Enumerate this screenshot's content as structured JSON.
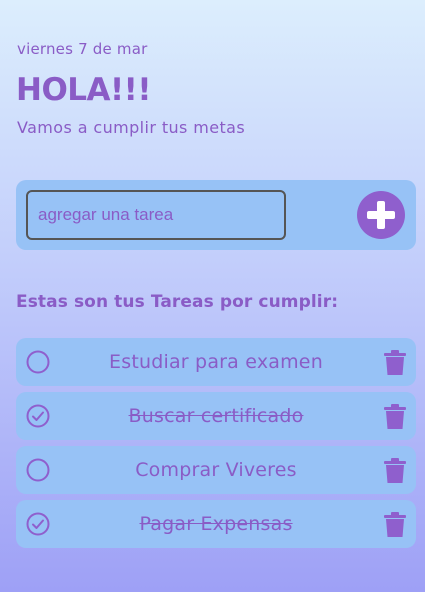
{
  "header": {
    "date": "viernes 7 de mar",
    "title": "HOLA!!!",
    "subtitle": "Vamos a cumplir tus metas"
  },
  "add_task": {
    "placeholder": "agregar una tarea",
    "value": "",
    "button_icon": "plus-icon"
  },
  "section_heading": "Estas son tus Tareas por cumplir:",
  "tasks": [
    {
      "text": "Estudiar para examen",
      "done": false
    },
    {
      "text": "Buscar certificado",
      "done": true
    },
    {
      "text": "Comprar Viveres",
      "done": false
    },
    {
      "text": "Pagar Expensas",
      "done": true
    }
  ],
  "icons": {
    "unchecked": "circle-icon",
    "checked": "check-circle-icon",
    "delete": "trash-icon"
  },
  "colors": {
    "accent": "#8f5fcd",
    "panel": "#97c2f6",
    "background_top": "#dceefd",
    "background_bottom": "#9ea0f6"
  }
}
